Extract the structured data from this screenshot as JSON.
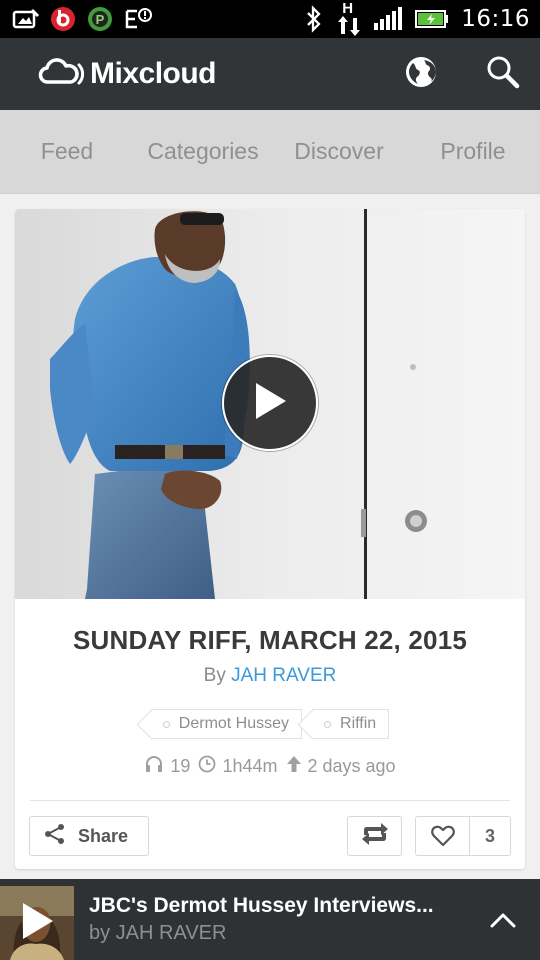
{
  "status_bar": {
    "time": "16:16",
    "network_label": "H",
    "icons": [
      "image-icon",
      "beats-icon",
      "parking-icon",
      "notification-icon",
      "bluetooth-icon",
      "network-h-icon",
      "signal-icon",
      "battery-charging-icon"
    ]
  },
  "header": {
    "app_name": "Mixcloud",
    "logo_icon": "mixcloud-cloud-icon",
    "actions": [
      "globe-icon",
      "search-icon"
    ]
  },
  "tabs": [
    {
      "label": "Feed"
    },
    {
      "label": "Categories"
    },
    {
      "label": "Discover"
    },
    {
      "label": "Profile"
    }
  ],
  "mix": {
    "title": "SUNDAY RIFF, MARCH 22, 2015",
    "by_prefix": "By",
    "author": "JAH RAVER",
    "tags": [
      "Dermot Hussey",
      "Riffin"
    ],
    "plays": "19",
    "duration": "1h44m",
    "uploaded": "2 days ago",
    "share_label": "Share",
    "favorite_count": "3"
  },
  "player": {
    "title": "JBC's Dermot Hussey Interviews...",
    "subtitle": "by JAH RAVER"
  },
  "colors": {
    "header_bg": "#323537",
    "tabs_bg": "#d8d8d8",
    "accent_link": "#3a9ad9",
    "player_bg": "#2f3234"
  }
}
